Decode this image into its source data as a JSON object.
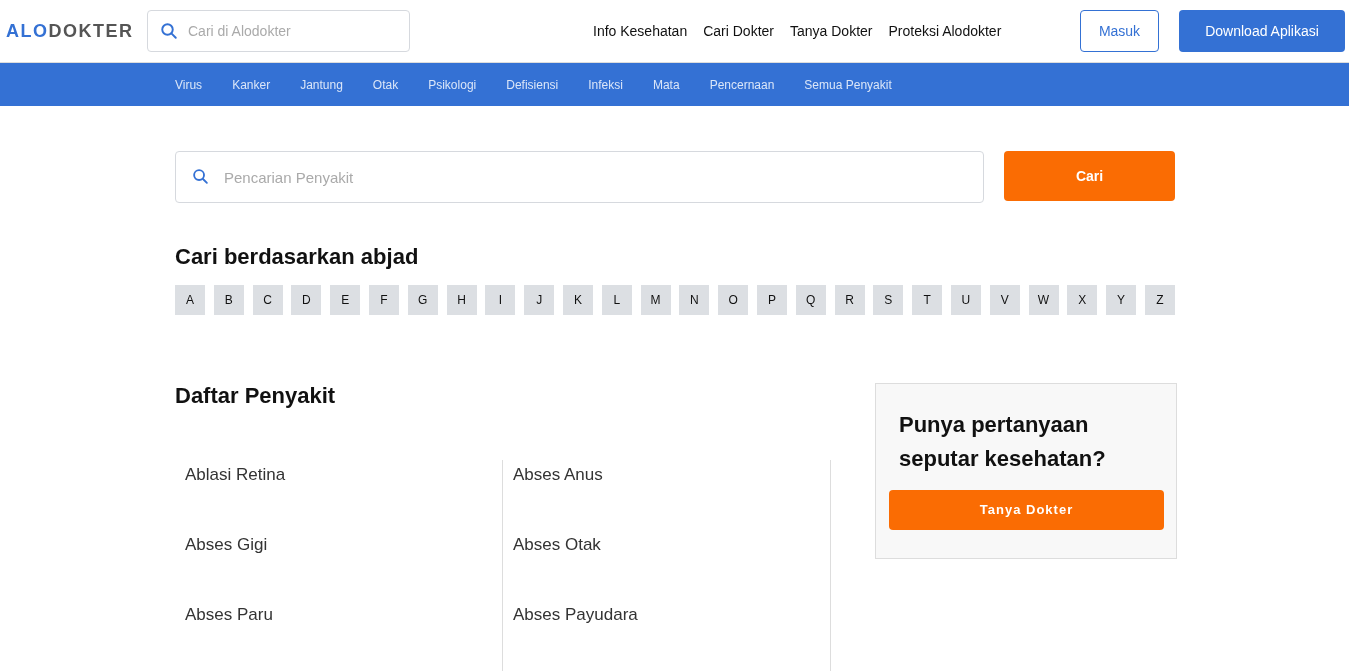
{
  "header": {
    "logo": {
      "accent": "ALO",
      "rest": "DOKTER"
    },
    "search": {
      "placeholder": "Cari di Alodokter"
    },
    "nav": [
      "Info Kesehatan",
      "Cari Dokter",
      "Tanya Dokter",
      "Proteksi Alodokter"
    ],
    "login": "Masuk",
    "download": "Download Aplikasi"
  },
  "categories": [
    "Virus",
    "Kanker",
    "Jantung",
    "Otak",
    "Psikologi",
    "Defisiensi",
    "Infeksi",
    "Mata",
    "Pencernaan",
    "Semua Penyakit"
  ],
  "search": {
    "placeholder": "Pencarian Penyakit",
    "button": "Cari"
  },
  "alphabet": {
    "title": "Cari berdasarkan abjad",
    "letters": [
      "A",
      "B",
      "C",
      "D",
      "E",
      "F",
      "G",
      "H",
      "I",
      "J",
      "K",
      "L",
      "M",
      "N",
      "O",
      "P",
      "Q",
      "R",
      "S",
      "T",
      "U",
      "V",
      "W",
      "X",
      "Y",
      "Z"
    ]
  },
  "diseases": {
    "title": "Daftar Penyakit",
    "columns": [
      [
        "Ablasi Retina",
        "Abses Gigi",
        "Abses Paru"
      ],
      [
        "Abses Anus",
        "Abses Otak",
        "Abses Payudara"
      ]
    ]
  },
  "ask_card": {
    "title": "Punya pertanyaan seputar kesehatan?",
    "button": "Tanya Dokter"
  }
}
